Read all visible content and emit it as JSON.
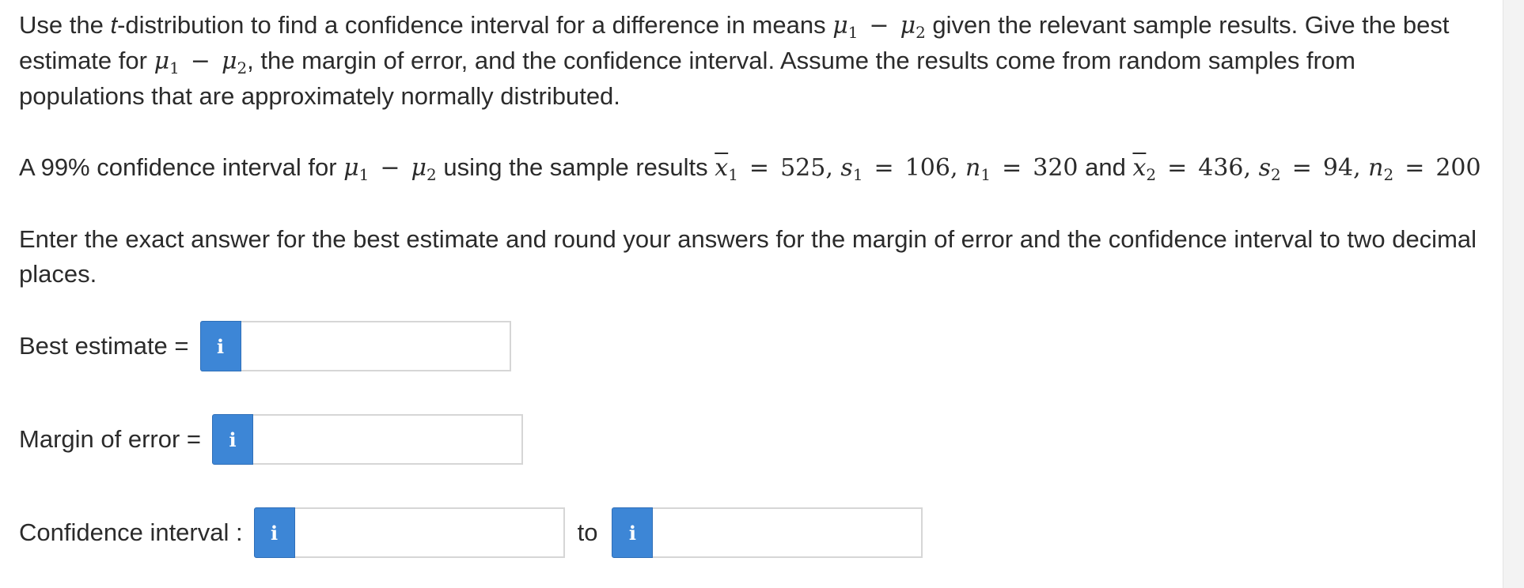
{
  "question": {
    "intro": {
      "p1": "Use the ",
      "t": "t",
      "p2": "-distribution to find a confidence interval for a difference in means ",
      "p3": " given the relevant sample results. Give the best estimate for ",
      "p4": ", the margin of error, and the confidence interval. Assume the results come from random samples from populations that are approximately normally distributed."
    },
    "math": {
      "mu": "μ",
      "sub1": "1",
      "sub2": "2",
      "minus": "−",
      "equals": "=",
      "x": "x",
      "s": "s",
      "n": "n",
      "x1_value": "525",
      "s1_value": "106",
      "n1_value": "320",
      "x2_value": "436",
      "s2_value": "94",
      "n2_value": "200",
      "sep": ", "
    },
    "problem": {
      "p1": "A 99% confidence interval for ",
      "p2": " using the sample results ",
      "and": " and "
    },
    "instructions": "Enter the exact answer for the best estimate and round your answers for the margin of error and the confidence interval to two decimal places."
  },
  "answers": {
    "best_estimate": {
      "label": "Best estimate =",
      "value": "",
      "info_icon": "info-icon"
    },
    "margin_of_error": {
      "label": "Margin of error =",
      "value": "",
      "info_icon": "info-icon"
    },
    "confidence_interval": {
      "label": "Confidence interval :",
      "to_label": "to",
      "lower_value": "",
      "upper_value": ""
    }
  },
  "icons": {
    "info_glyph": "i"
  },
  "colors": {
    "info_button": "#3d86d6",
    "text": "#2b2b2b",
    "field_border": "#d6d6d6"
  }
}
